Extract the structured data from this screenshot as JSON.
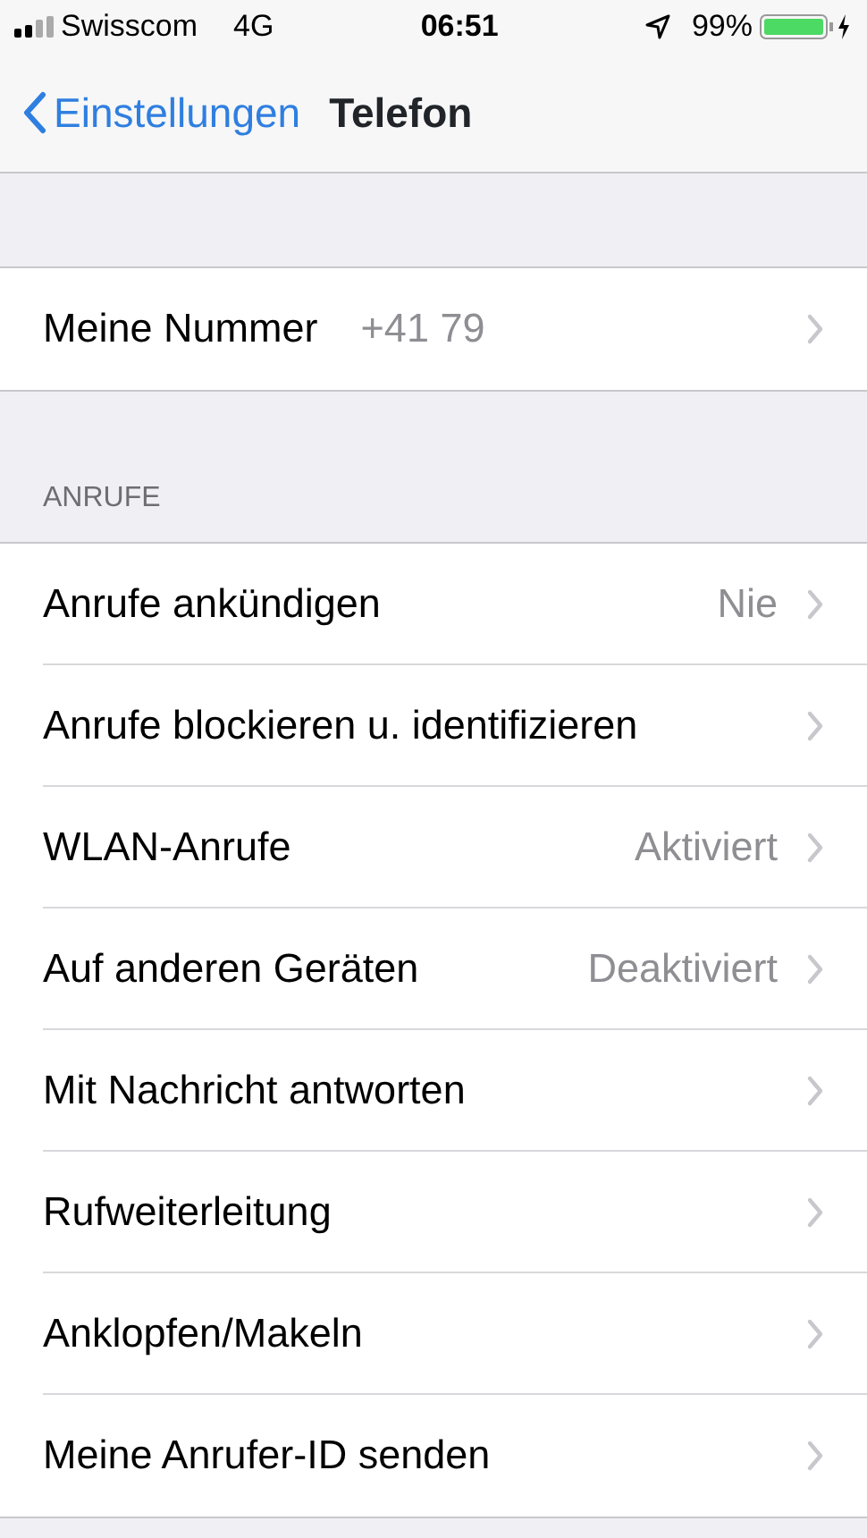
{
  "status_bar": {
    "carrier": "Swisscom",
    "network": "4G",
    "time": "06:51",
    "battery": "99%"
  },
  "nav": {
    "back": "Einstellungen",
    "title": "Telefon"
  },
  "sections": [
    {
      "rows": [
        {
          "kind": "inline",
          "label": "Meine Nummer",
          "value": "+41 79"
        }
      ]
    },
    {
      "header": "ANRUFE",
      "rows": [
        {
          "kind": "trailing",
          "label": "Anrufe ankündigen",
          "value": "Nie"
        },
        {
          "kind": "trailing",
          "label": "Anrufe blockieren u. identifizieren"
        },
        {
          "kind": "trailing",
          "label": "WLAN-Anrufe",
          "value": "Aktiviert"
        },
        {
          "kind": "trailing",
          "label": "Auf anderen Geräten",
          "value": "Deaktiviert"
        },
        {
          "kind": "trailing",
          "label": "Mit Nachricht antworten"
        },
        {
          "kind": "trailing",
          "label": "Rufweiterleitung"
        },
        {
          "kind": "trailing",
          "label": "Anklopfen/Makeln"
        },
        {
          "kind": "trailing",
          "label": "Meine Anrufer-ID senden"
        }
      ]
    }
  ]
}
